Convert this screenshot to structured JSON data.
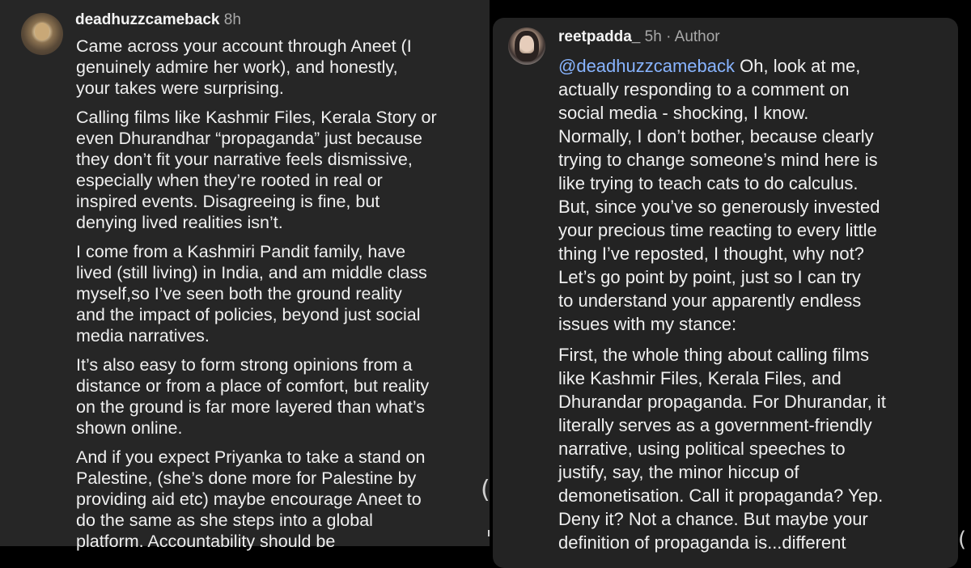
{
  "left_comment": {
    "username": "deadhuzzcameback",
    "time": "8h",
    "paragraphs": [
      [
        "Came across your account through Aneet (I",
        "genuinely admire her work), and honestly,",
        "your takes were surprising."
      ],
      [
        "Calling films like Kashmir Files, Kerala Story or",
        "even Dhurandhar “propaganda” just because",
        "they don’t fit your narrative feels dismissive,",
        "especially when they’re rooted in real or",
        "inspired events. Disagreeing is fine, but",
        "denying lived realities isn’t."
      ],
      [
        "I come from a Kashmiri Pandit family, have",
        "lived (still living) in India, and am middle class",
        "myself,so I’ve seen both the ground reality",
        "and the impact of policies, beyond just social",
        "media narratives."
      ],
      [
        "It’s also easy to form strong opinions from a",
        "distance or from a place of comfort, but reality",
        "on the ground is far more layered than what’s",
        "shown online."
      ],
      [
        "And if you expect Priyanka to take a stand on",
        "Palestine, (she’s done more for Palestine by",
        "providing aid etc) maybe encourage Aneet to",
        "do the same as she steps into a global",
        "platform. Accountability should be"
      ]
    ]
  },
  "right_comment": {
    "username": "reetpadda_",
    "time": "5h",
    "separator": "·",
    "badge": "Author",
    "mention": "@deadhuzzcameback",
    "first_line_rest": " Oh, look at me,",
    "paragraphs": [
      [
        "actually responding to a comment on",
        "social media - shocking, I know.",
        "Normally, I don’t bother, because clearly",
        "trying to change someone’s mind here is",
        "like trying to teach cats to do calculus.",
        "But, since you’ve so generously invested",
        "your precious time reacting to every little",
        "thing I’ve reposted, I thought, why not?",
        "Let’s go point by point, just so I can try",
        "to understand your apparently endless",
        "issues with my stance:"
      ],
      [
        "First, the whole thing about calling films",
        "like Kashmir Files, Kerala Files, and",
        "Dhurandar propaganda. For Dhurandar, it",
        "literally serves as a government-friendly",
        "narrative, using political speeches to",
        "justify, say, the minor hiccup of",
        "demonetisation. Call it propaganda? Yep.",
        "Deny it? Not a chance. But maybe your",
        "definition of propaganda is...different"
      ]
    ]
  },
  "edge_glyphs": {
    "middle": "(",
    "right": "("
  },
  "colors": {
    "left_card": "#262626",
    "right_card": "#232323",
    "mention": "#88b4ff",
    "meta": "#a8a8a8"
  }
}
